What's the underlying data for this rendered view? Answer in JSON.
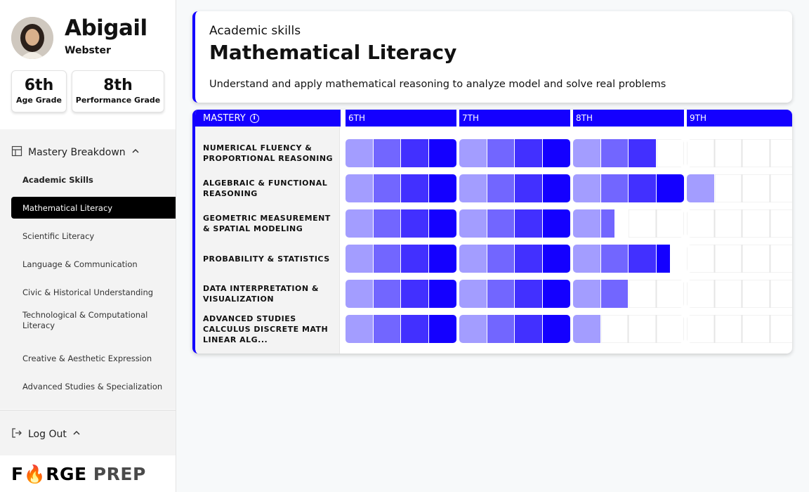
{
  "profile": {
    "first_name": "Abigail",
    "last_name": "Webster",
    "age_grade": {
      "value": "6th",
      "label": "Age Grade"
    },
    "performance_grade": {
      "value": "8th",
      "label": "Performance Grade"
    }
  },
  "nav": {
    "header": "Mastery Breakdown",
    "items": [
      {
        "label": "Academic Skills",
        "state": "bold"
      },
      {
        "label": "Mathematical Literacy",
        "state": "active"
      },
      {
        "label": "Scientific Literacy",
        "state": "normal"
      },
      {
        "label": "Language & Communication",
        "state": "normal"
      },
      {
        "label": "Civic & Historical Understanding",
        "state": "normal"
      },
      {
        "label": "Technological & Computational Literacy",
        "state": "normal"
      },
      {
        "label": "Creative & Aesthetic Expression",
        "state": "normal"
      },
      {
        "label": "Advanced Studies & Specialization",
        "state": "normal"
      }
    ],
    "logout": "Log Out"
  },
  "brand": {
    "part1": "F",
    "part1b": "RGE",
    "part2": "PREP"
  },
  "skill": {
    "category": "Academic skills",
    "title": "Mathematical Literacy",
    "description": "Understand and apply mathematical reasoning to analyze model and solve real problems"
  },
  "mastery": {
    "header": "MASTERY",
    "grades": [
      "6TH",
      "7TH",
      "8TH",
      "9TH"
    ],
    "rows": [
      {
        "label": "NUMERICAL FLUENCY & PROPORTIONAL REASONING",
        "levels": [
          4,
          4,
          3,
          0
        ]
      },
      {
        "label": "ALGEBRAIC & FUNCTIONAL REASONING",
        "levels": [
          4,
          4,
          4,
          1
        ]
      },
      {
        "label": "GEOMETRIC MEASUREMENT & SPATIAL MODELING",
        "levels": [
          4,
          4,
          1.5,
          0
        ]
      },
      {
        "label": "PROBABILITY & STATISTICS",
        "levels": [
          4,
          4,
          3.5,
          0
        ]
      },
      {
        "label": "DATA INTERPRETATION & VISUALIZATION",
        "levels": [
          4,
          4,
          2,
          0
        ]
      },
      {
        "label": "ADVANCED STUDIES CALCULUS DISCRETE MATH LINEAR ALG...",
        "levels": [
          4,
          4,
          1,
          0
        ]
      }
    ],
    "colors": [
      "#a39dff",
      "#7266ff",
      "#4230ff",
      "#1400ff"
    ]
  }
}
